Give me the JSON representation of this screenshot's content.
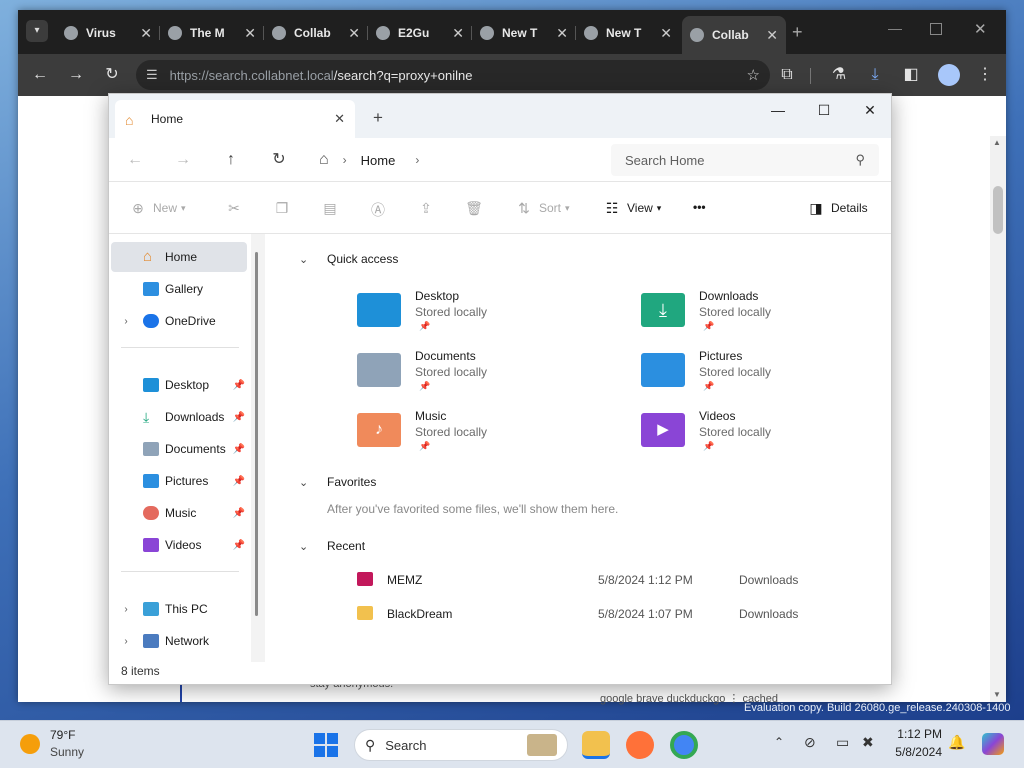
{
  "browser": {
    "tabs": [
      {
        "title": "Virus",
        "icon": "github-icon"
      },
      {
        "title": "The M",
        "icon": "museum-icon"
      },
      {
        "title": "Collab",
        "icon": "collab-icon"
      },
      {
        "title": "E2Gu",
        "icon": "globe-icon"
      },
      {
        "title": "New T",
        "icon": "globe-icon"
      },
      {
        "title": "New T",
        "icon": "globe-icon"
      },
      {
        "title": "Collab",
        "icon": "collab-icon"
      }
    ],
    "new_tab": "+",
    "url_host": "https://search.collabnet.local",
    "url_path": "/search?q=proxy+onilne"
  },
  "explorer": {
    "tab_title": "Home",
    "new_tab": "+",
    "breadcrumb": "Home",
    "search_placeholder": "Search Home",
    "commands": {
      "new": "New",
      "sort": "Sort",
      "view": "View",
      "more": "•••",
      "details": "Details"
    },
    "sidebar": {
      "home": "Home",
      "gallery": "Gallery",
      "onedrive": "OneDrive",
      "desktop": "Desktop",
      "downloads": "Downloads",
      "documents": "Documents",
      "pictures": "Pictures",
      "music": "Music",
      "videos": "Videos",
      "this_pc": "This PC",
      "network": "Network"
    },
    "status": "8 items",
    "quick_access": {
      "header": "Quick access",
      "items": [
        {
          "name": "Desktop",
          "status": "Stored locally",
          "color": "#1e90d8"
        },
        {
          "name": "Downloads",
          "status": "Stored locally",
          "color": "#20a77f"
        },
        {
          "name": "Documents",
          "status": "Stored locally",
          "color": "#8fa3b8"
        },
        {
          "name": "Pictures",
          "status": "Stored locally",
          "color": "#2b8fe0"
        },
        {
          "name": "Music",
          "status": "Stored locally",
          "color": "#f08a5b"
        },
        {
          "name": "Videos",
          "status": "Stored locally",
          "color": "#8a45d6"
        }
      ]
    },
    "favorites": {
      "header": "Favorites",
      "empty_text": "After you've favorited some files, we'll show them here."
    },
    "recent": {
      "header": "Recent",
      "items": [
        {
          "name": "MEMZ",
          "date": "5/8/2024 1:12 PM",
          "location": "Downloads"
        },
        {
          "name": "BlackDream",
          "date": "5/8/2024 1:07 PM",
          "location": "Downloads"
        }
      ]
    }
  },
  "taskbar": {
    "weather_temp": "79°F",
    "weather_desc": "Sunny",
    "search_label": "Search",
    "time": "1:12 PM",
    "date": "5/8/2024"
  },
  "watermark": "Evaluation copy. Build 26080.ge_release.240308-1400"
}
